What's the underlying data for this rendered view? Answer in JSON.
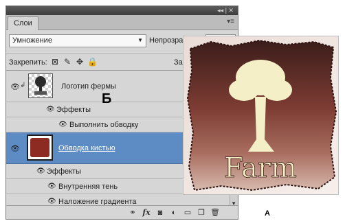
{
  "panel": {
    "tab_label": "Слои",
    "blend_mode": "Умножение",
    "opacity_label": "Непрозрачн",
    "lock_label": "Закрепить:",
    "fill_label": "Зал"
  },
  "layers": [
    {
      "name": "Логотип фермы",
      "visible": true,
      "effects_label": "Эффекты",
      "effects": [
        "Выполнить обводку"
      ]
    },
    {
      "name": "Обводка кистью",
      "visible": true,
      "selected": true,
      "effects_label": "Эффекты",
      "effects": [
        "Внутренняя тень",
        "Наложение градиента"
      ]
    }
  ],
  "icons": {
    "titlebar": [
      "collapse-icon",
      "close-icon"
    ],
    "panel_menu": "panel-menu-icon",
    "lock": [
      "lock-transparent-icon",
      "lock-brush-icon",
      "lock-move-icon",
      "lock-all-icon"
    ],
    "bottom": [
      "link-layers-icon",
      "fx-icon",
      "layer-mask-icon",
      "adjustment-layer-icon",
      "new-group-icon",
      "new-layer-icon",
      "trash-icon"
    ]
  },
  "image": {
    "logo_text": "Farm"
  },
  "callouts": {
    "b": "Б",
    "a": "A"
  },
  "colors": {
    "selected_row": "#5d8bc4",
    "brush_swatch": "#8d2b22",
    "logo_cream": "#f4efc6"
  }
}
